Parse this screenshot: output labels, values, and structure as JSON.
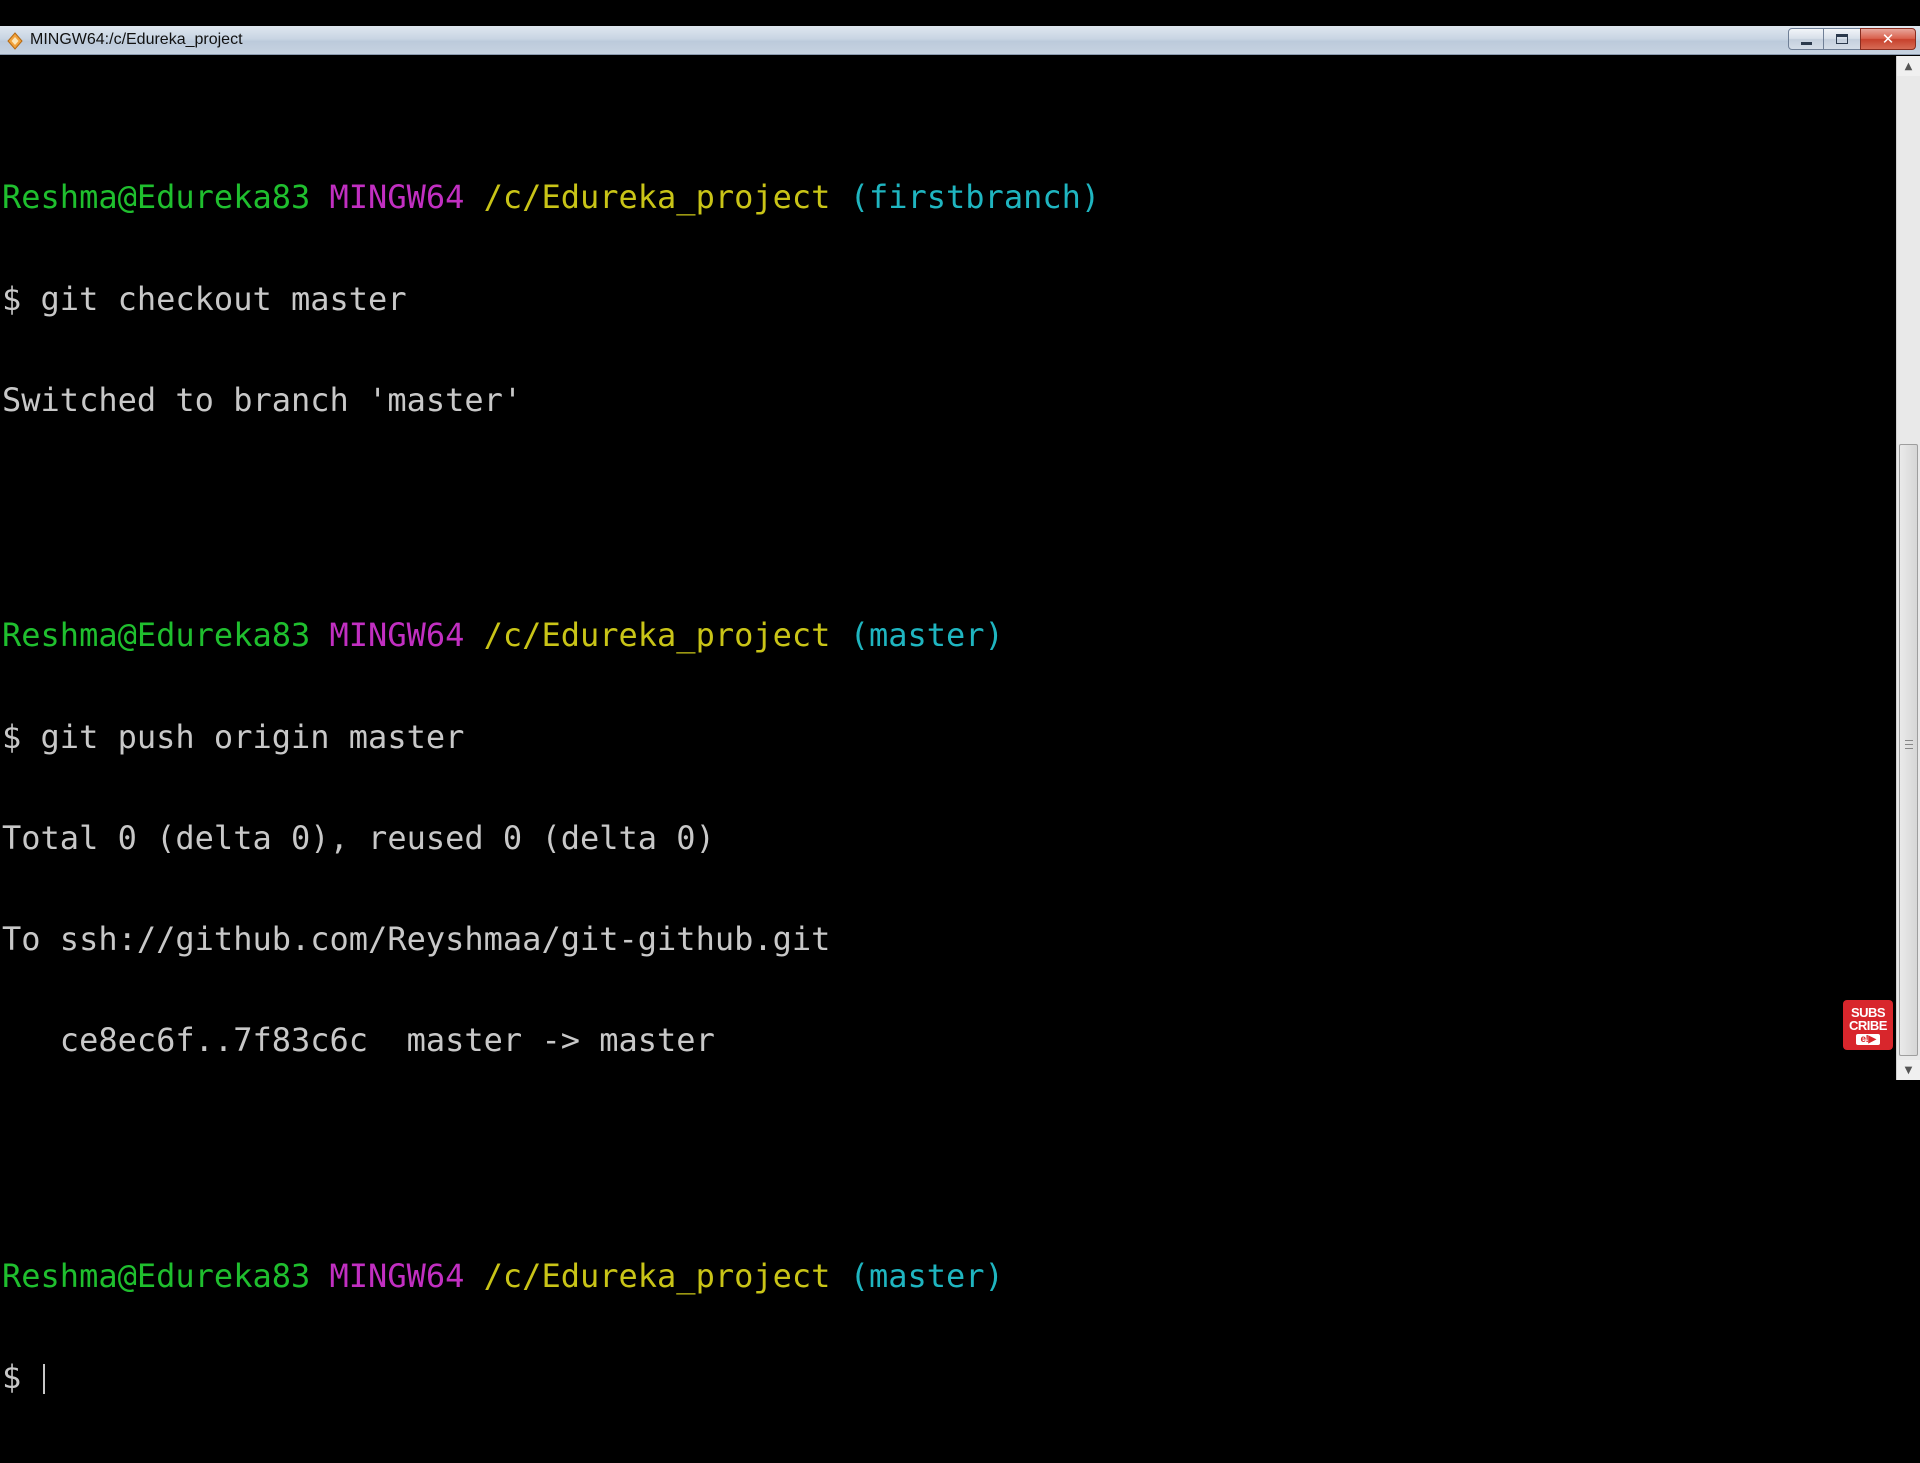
{
  "window": {
    "title": "MINGW64:/c/Edureka_project",
    "app_icon": "mingw-icon",
    "controls": {
      "minimize": "minimize-icon",
      "maximize": "restore-icon",
      "close": "✕"
    }
  },
  "colors": {
    "user_host": "#1fbf2e",
    "mingw": "#c12fc1",
    "path": "#c9c417",
    "branch": "#1fb5c0",
    "output": "#c8c8c8",
    "background": "#000000"
  },
  "terminal": {
    "prompt1": {
      "user": "Reshma@Edureka83",
      "system": "MINGW64",
      "path": "/c/Edureka_project",
      "branch": "(firstbranch)"
    },
    "cmd1": "$ git checkout master",
    "out1": [
      "Switched to branch 'master'"
    ],
    "prompt2": {
      "user": "Reshma@Edureka83",
      "system": "MINGW64",
      "path": "/c/Edureka_project",
      "branch": "(master)"
    },
    "cmd2": "$ git push origin master",
    "out2": [
      "Total 0 (delta 0), reused 0 (delta 0)",
      "To ssh://github.com/Reyshmaa/git-github.git",
      "   ce8ec6f..7f83c6c  master -> master"
    ],
    "prompt3": {
      "user": "Reshma@Edureka83",
      "system": "MINGW64",
      "path": "/c/Edureka_project",
      "branch": "(master)"
    },
    "input_prompt": "$ "
  },
  "overlay": {
    "subscribe_line1": "SUBS",
    "subscribe_line2": "CRIBE",
    "subscribe_logo": "e!▶"
  }
}
